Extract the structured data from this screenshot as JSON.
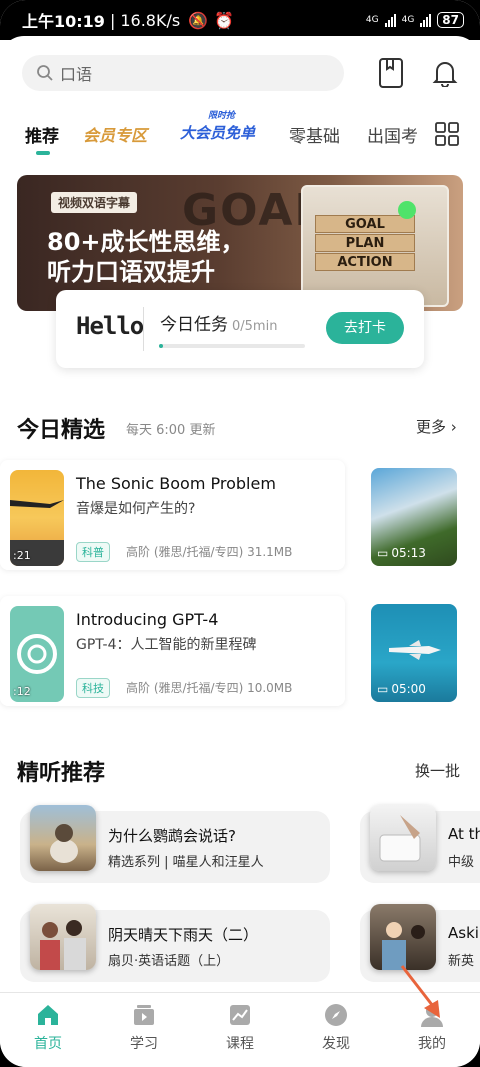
{
  "status": {
    "time": "上午10:19",
    "speed": "16.8K/s",
    "net1": "4G",
    "net2": "4G",
    "battery": "87"
  },
  "search": {
    "placeholder": "口语"
  },
  "tabs": [
    {
      "label": "推荐",
      "active": true
    },
    {
      "label": "会员专区"
    },
    {
      "label": "大会员免单",
      "small": "限时抢"
    },
    {
      "label": "零基础"
    },
    {
      "label": "出国考"
    }
  ],
  "banner": {
    "tag": "视频双语字幕",
    "line1": "80+成长性思维，",
    "line2": "听力口语双提升",
    "blocks": [
      "GOAL",
      "PLAN",
      "ACTION"
    ],
    "bg_text": "GOAL"
  },
  "task": {
    "hello": "Hello",
    "title": "今日任务",
    "progress": "0/5min",
    "progress_fraction": 0.0,
    "button": "去打卡"
  },
  "featured": {
    "title": "今日精选",
    "subtitle": "每天 6:00 更新",
    "more": "更多",
    "items": [
      {
        "title": "The Sonic Boom Problem",
        "subtitle": "音爆是如何产生的?",
        "badge": "科普",
        "meta": "高阶 (雅思/托福/专四)  31.1MB",
        "duration": ":21",
        "side_duration": "05:13"
      },
      {
        "title": "Introducing GPT-4",
        "subtitle": "GPT-4：人工智能的新里程碑",
        "badge": "科技",
        "meta": "高阶 (雅思/托福/专四)  10.0MB",
        "duration": ":12",
        "side_duration": "05:00"
      }
    ]
  },
  "listening": {
    "title": "精听推荐",
    "refresh": "换一批",
    "items": [
      {
        "title": "为什么鹦鹉会说话?",
        "subtitle": "精选系列 | 喵星人和汪星人"
      },
      {
        "title": "At th",
        "subtitle": "中级"
      },
      {
        "title": "阴天晴天下雨天（二）",
        "subtitle": "扇贝·英语话题（上）"
      },
      {
        "title": "Aski",
        "subtitle": "新英"
      }
    ]
  },
  "nav": [
    {
      "label": "首页",
      "icon": "home-icon",
      "active": true
    },
    {
      "label": "学习",
      "icon": "study-icon"
    },
    {
      "label": "课程",
      "icon": "course-icon"
    },
    {
      "label": "发现",
      "icon": "compass-icon"
    },
    {
      "label": "我的",
      "icon": "profile-icon"
    }
  ],
  "colors": {
    "accent": "#2bb39a",
    "vip": "#d89a3a",
    "arrow": "#e8643c"
  }
}
